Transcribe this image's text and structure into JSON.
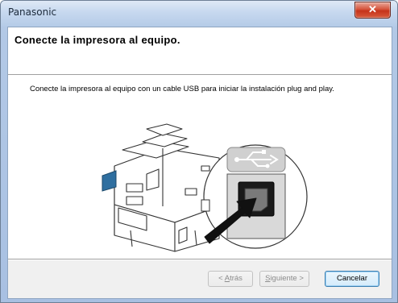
{
  "window": {
    "title": "Panasonic",
    "close_glyph": "✕"
  },
  "header": {
    "title": "Conecte la impresora al equipo."
  },
  "body": {
    "instruction": "Conecte la impresora al equipo con un cable USB para iniciar la instalación plug and play.",
    "illustration_icon": "usb-icon"
  },
  "buttons": {
    "back": {
      "prefix": "< ",
      "accel": "A",
      "rest": "trás",
      "enabled": false
    },
    "next": {
      "accel": "S",
      "rest": "iguiente >",
      "enabled": false
    },
    "cancel": {
      "label": "Cancelar",
      "enabled": true
    }
  },
  "colors": {
    "accent": "#3c7fb1",
    "title_bar": "#c6d8ef",
    "close_button": "#d5533b",
    "tray_accent": "#2f6fa0"
  }
}
